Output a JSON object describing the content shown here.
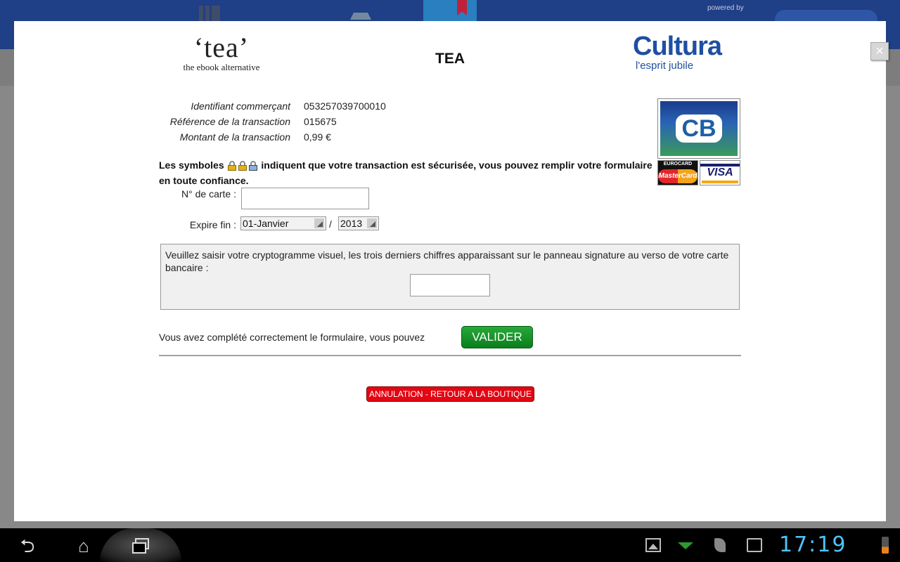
{
  "background_app": {
    "powered_by": "powered by"
  },
  "modal": {
    "close_label": "×",
    "tea_logo_word": "‘tea’",
    "tea_logo_tagline": "the ebook alternative",
    "title": "TEA",
    "cultura_logo_word": "Cultura",
    "cultura_logo_tagline": "l'esprit jubile",
    "info": [
      {
        "label": "Identifiant commerçant",
        "value": "053257039700010"
      },
      {
        "label": "Référence de la transaction",
        "value": "015675"
      },
      {
        "label": "Montant de la transaction",
        "value": "0,99 €"
      }
    ],
    "cards": {
      "cb": "CB",
      "eurocard": "EUROCARD",
      "mastercard": "MasterCard",
      "visa": "VISA"
    },
    "secure_text_before": "Les symboles",
    "secure_text_after": "indiquent que votre transaction est sécurisée, vous pouvez remplir votre formulaire en toute confiance.",
    "card_number_label": "N° de carte :",
    "card_number_value": "",
    "expire_label": "Expire fin :",
    "expire_month": "01-Janvier",
    "expire_separator": "/",
    "expire_year": "2013",
    "crypto_text": "Veuillez saisir votre cryptogramme visuel, les trois derniers chiffres apparaissant sur le panneau signature au verso de votre carte bancaire :",
    "crypto_value": "",
    "complete_text": "Vous avez complété correctement le formulaire, vous pouvez",
    "valider_label": "VALIDER",
    "cancel_label": "ANNULATION - RETOUR A LA BOUTIQUE",
    "colors": {
      "valider": "#1a9a2c",
      "cancel": "#e30613",
      "cultura": "#1e4fa3"
    }
  },
  "status_bar": {
    "time": "17:19"
  },
  "icons": [
    "back-icon",
    "home-icon",
    "recent-apps-icon",
    "gallery-icon",
    "download-icon",
    "leaf-icon",
    "shopping-bag-icon",
    "wifi-icon",
    "battery-icon",
    "lock-icon"
  ]
}
